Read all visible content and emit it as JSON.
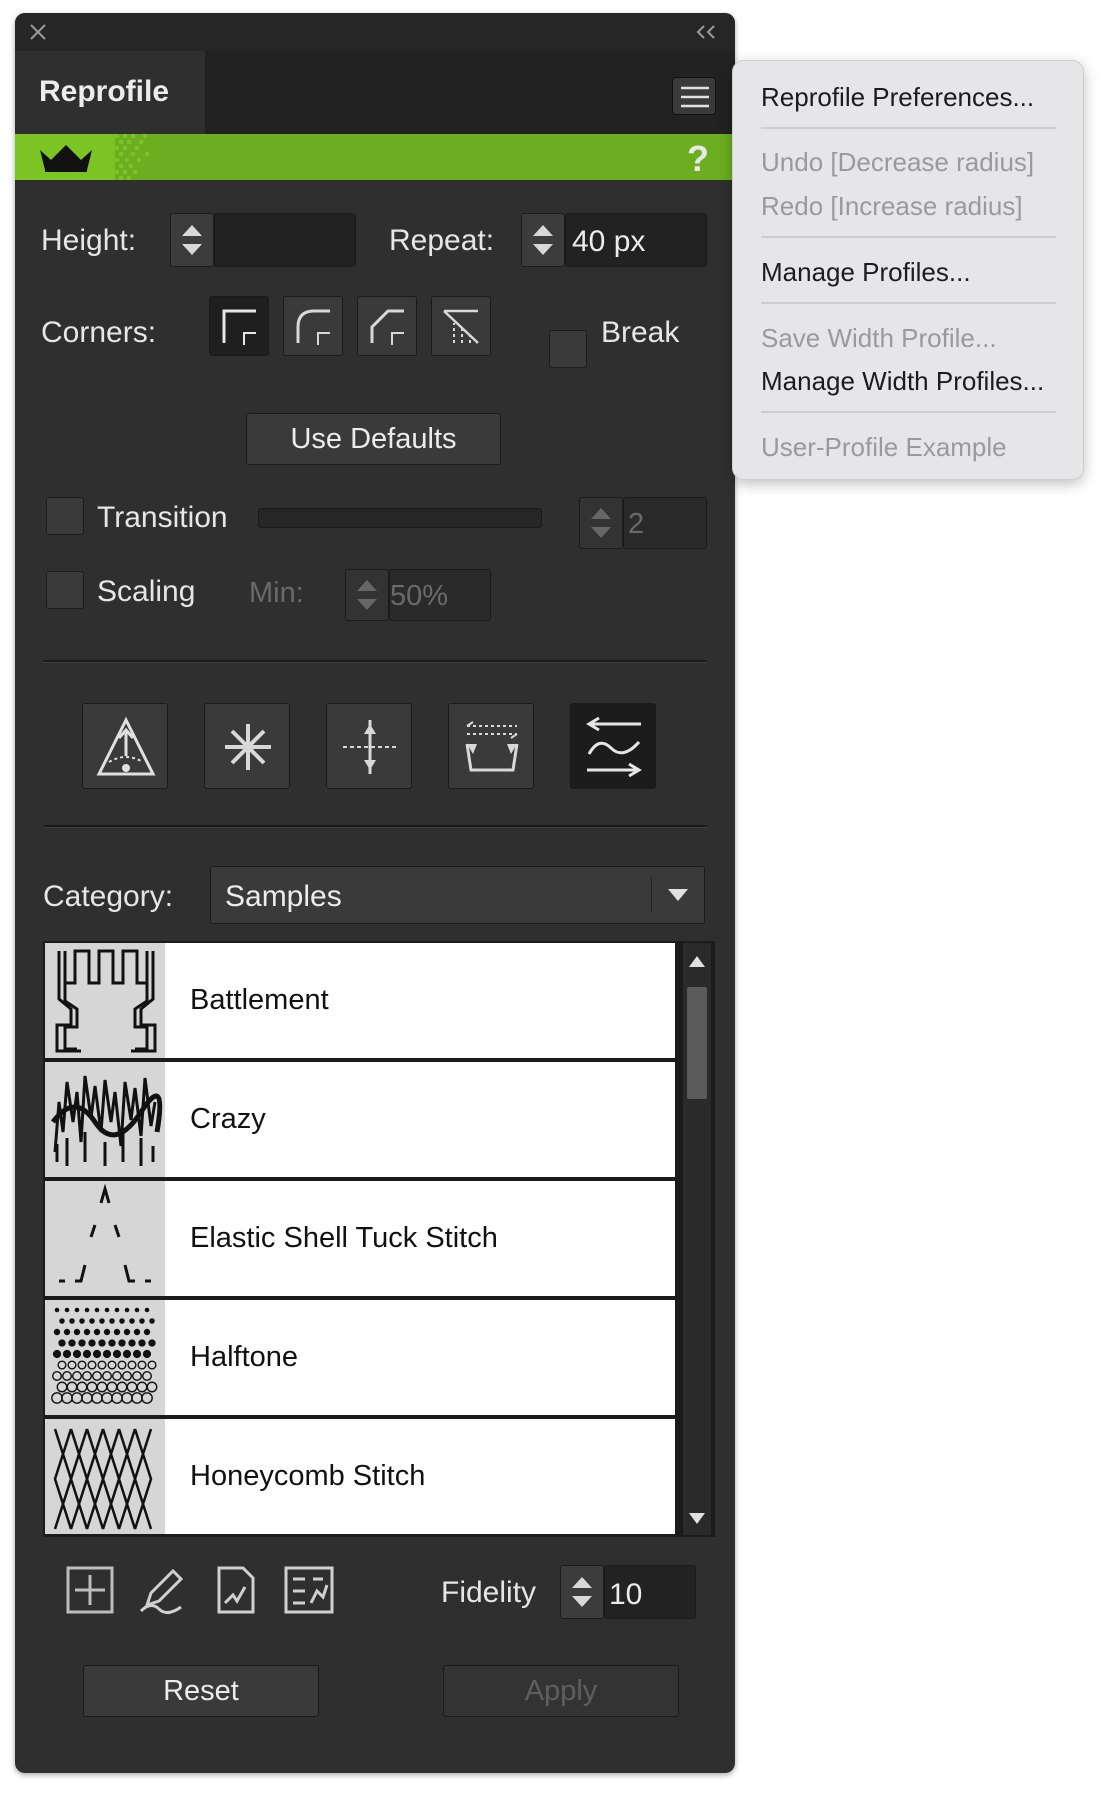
{
  "panel": {
    "tab_title": "Reprofile",
    "help_glyph": "?",
    "height_label": "Height:",
    "height_value": "",
    "repeat_label": "Repeat:",
    "repeat_value": "40 px",
    "corners_label": "Corners:",
    "break_label": "Break",
    "use_defaults_label": "Use Defaults",
    "transition_label": "Transition",
    "transition_value": "2",
    "scaling_label": "Scaling",
    "min_label": "Min:",
    "min_value": "50%",
    "category_label": "Category:",
    "category_value": "Samples",
    "profiles": [
      {
        "name": "Battlement"
      },
      {
        "name": "Crazy"
      },
      {
        "name": "Elastic Shell Tuck Stitch"
      },
      {
        "name": "Halftone"
      },
      {
        "name": "Honeycomb Stitch"
      }
    ],
    "fidelity_label": "Fidelity",
    "fidelity_value": "10",
    "reset_label": "Reset",
    "apply_label": "Apply",
    "accent_color": "#6cae1f"
  },
  "menu": {
    "items": [
      {
        "label": "Reprofile Preferences...",
        "enabled": true
      },
      {
        "label": "Undo [Decrease radius]",
        "enabled": false
      },
      {
        "label": "Redo [Increase radius]",
        "enabled": false
      },
      {
        "label": "Manage Profiles...",
        "enabled": true
      },
      {
        "label": "Save Width Profile...",
        "enabled": false
      },
      {
        "label": "Manage Width Profiles...",
        "enabled": true
      },
      {
        "label": "User-Profile Example",
        "enabled": false
      }
    ]
  }
}
